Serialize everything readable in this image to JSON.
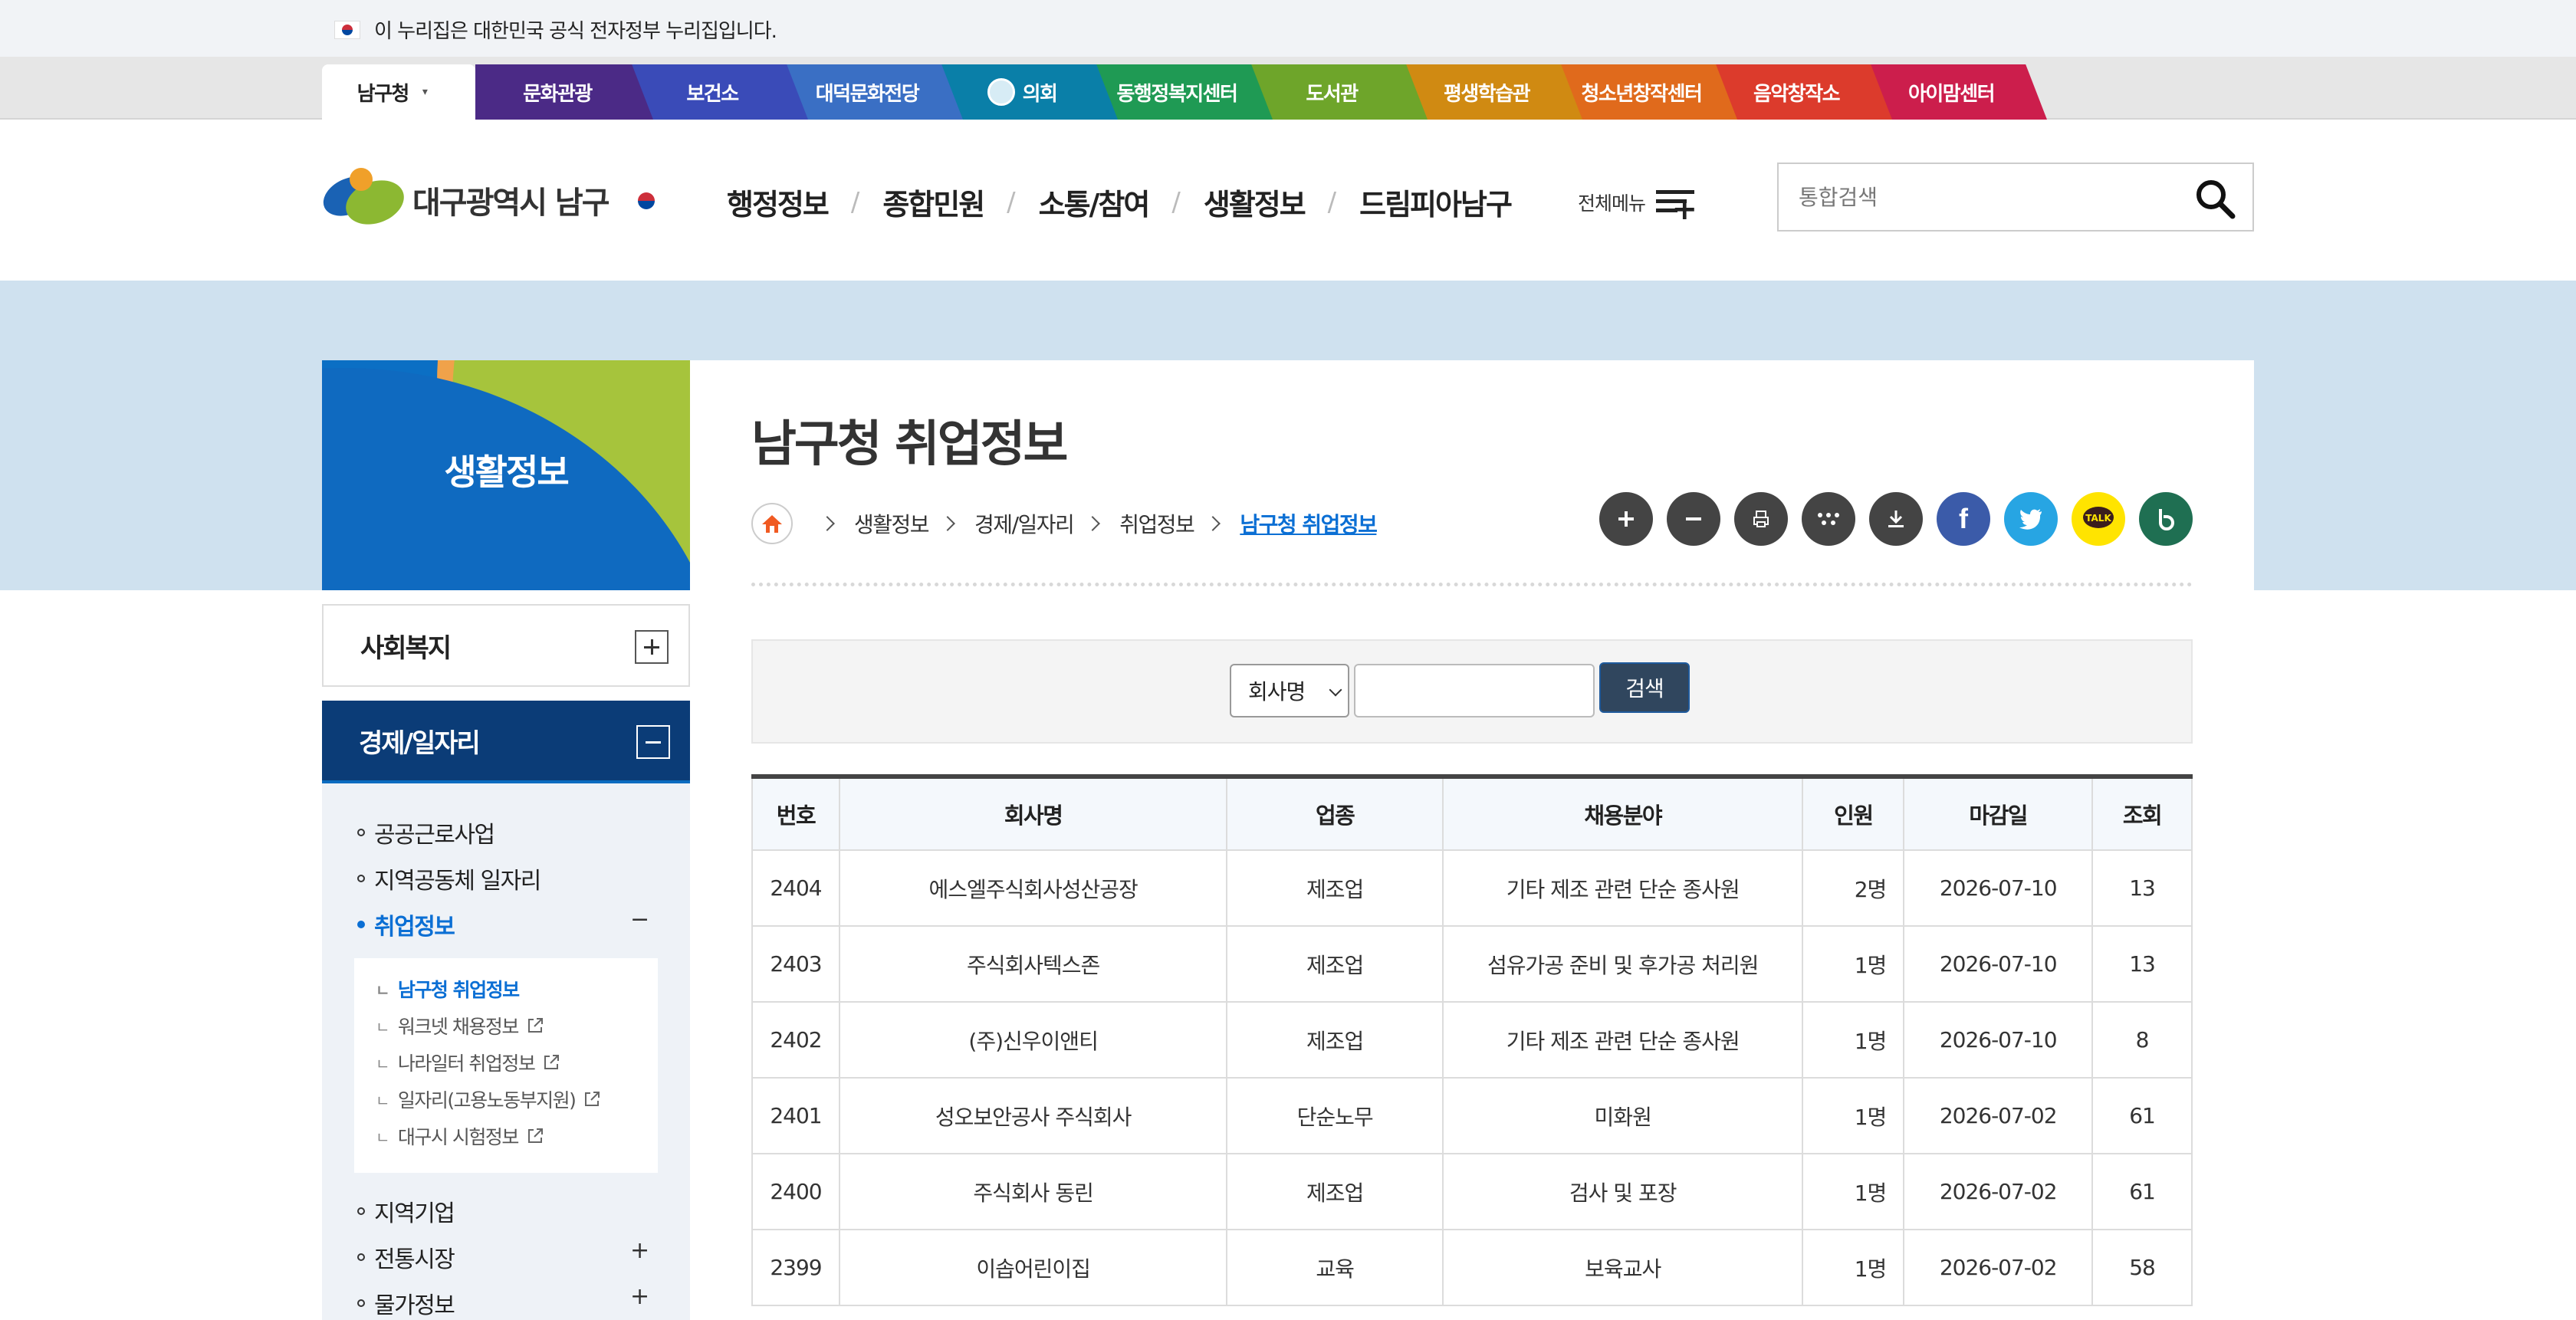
{
  "gov_banner": {
    "text": "이 누리집은 대한민국 공식 전자정부 누리집입니다."
  },
  "site_tabs": [
    {
      "label": "남구청",
      "color": "#ffffff",
      "active": true
    },
    {
      "label": "문화관광",
      "color": "#4b2a86"
    },
    {
      "label": "보건소",
      "color": "#3a4bb8"
    },
    {
      "label": "대덕문화전당",
      "color": "#3a6fc4"
    },
    {
      "label": "의회",
      "color": "#0a7fa8"
    },
    {
      "label": "동행정복지센터",
      "color": "#1f9a54"
    },
    {
      "label": "도서관",
      "color": "#6ea52a"
    },
    {
      "label": "평생학습관",
      "color": "#d08a12"
    },
    {
      "label": "청소년창작센터",
      "color": "#e06a1c"
    },
    {
      "label": "음악창작소",
      "color": "#dc3b2c"
    },
    {
      "label": "아이맘센터",
      "color": "#cc1e4c"
    }
  ],
  "header": {
    "logo_text": "대구광역시 남구",
    "gnb": [
      "행정정보",
      "종합민원",
      "소통/참여",
      "생활정보",
      "드림피아남구"
    ],
    "all_menu_label": "전체메뉴",
    "search_placeholder": "통합검색"
  },
  "lnb": {
    "title": "생활정보",
    "groups": [
      {
        "label": "사회복지",
        "open": false
      },
      {
        "label": "경제/일자리",
        "open": true
      }
    ],
    "items": [
      {
        "label": "공공근로사업"
      },
      {
        "label": "지역공동체 일자리"
      },
      {
        "label": "취업정보",
        "current": true,
        "toggle": "−"
      },
      {
        "label": "지역기업"
      },
      {
        "label": "전통시장",
        "toggle": "+"
      },
      {
        "label": "물가정보",
        "toggle": "+"
      }
    ],
    "sub_items": [
      {
        "label": "남구청 취업정보",
        "current": true,
        "external": false
      },
      {
        "label": "워크넷 채용정보",
        "external": true
      },
      {
        "label": "나라일터 취업정보",
        "external": true
      },
      {
        "label": "일자리(고용노동부지원)",
        "external": true
      },
      {
        "label": "대구시 시험정보",
        "external": true
      }
    ]
  },
  "content": {
    "title": "남구청 취업정보",
    "breadcrumb": [
      "생활정보",
      "경제/일자리",
      "취업정보",
      "남구청 취업정보"
    ],
    "tools": [
      {
        "icon": "zoom-in-icon",
        "glyph": "+"
      },
      {
        "icon": "zoom-out-icon",
        "glyph": "−"
      },
      {
        "icon": "print-icon",
        "glyph": "⎙"
      },
      {
        "icon": "share-icon",
        "glyph": "⁘"
      },
      {
        "icon": "download-icon",
        "glyph": "⤓"
      },
      {
        "icon": "facebook-icon",
        "glyph": "f"
      },
      {
        "icon": "twitter-icon",
        "glyph": "🐦"
      },
      {
        "icon": "kakaotalk-icon",
        "glyph": "TALK"
      },
      {
        "icon": "band-icon",
        "glyph": "b"
      }
    ],
    "search": {
      "select_value": "회사명",
      "button": "검색"
    },
    "table": {
      "headers": [
        "번호",
        "회사명",
        "업종",
        "채용분야",
        "인원",
        "마감일",
        "조회"
      ],
      "rows": [
        [
          "2404",
          "에스엘주식회사성산공장",
          "제조업",
          "기타 제조 관련 단순 종사원",
          "2명",
          "2026-07-10",
          "13"
        ],
        [
          "2403",
          "주식회사텍스존",
          "제조업",
          "섬유가공 준비 및 후가공 처리원",
          "1명",
          "2026-07-10",
          "13"
        ],
        [
          "2402",
          "(주)신우이앤티",
          "제조업",
          "기타 제조 관련 단순 종사원",
          "1명",
          "2026-07-10",
          "8"
        ],
        [
          "2401",
          "성오보안공사 주식회사",
          "단순노무",
          "미화원",
          "1명",
          "2026-07-02",
          "61"
        ],
        [
          "2400",
          "주식회사 동린",
          "제조업",
          "검사 및 포장",
          "1명",
          "2026-07-02",
          "61"
        ],
        [
          "2399",
          "이솝어린이집",
          "교육",
          "보육교사",
          "1명",
          "2026-07-02",
          "58"
        ]
      ]
    }
  }
}
